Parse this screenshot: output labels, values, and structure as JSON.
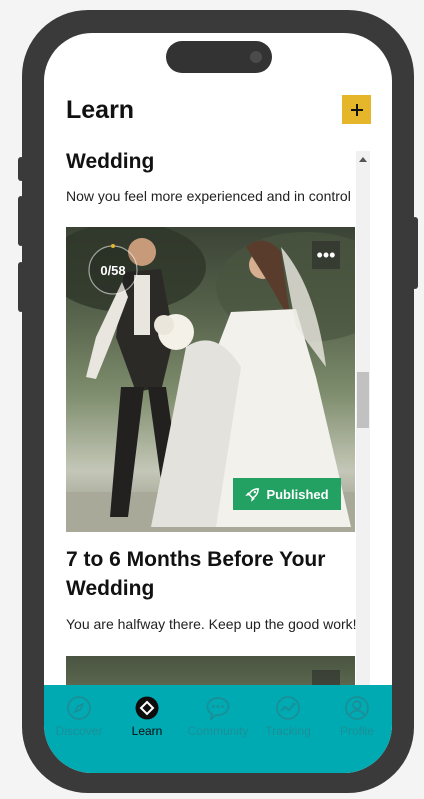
{
  "header": {
    "title": "Learn",
    "add_label": "+"
  },
  "cards": [
    {
      "title_line": "Wedding",
      "subtitle": "Now you feel more experienced and in control",
      "progress": "0/58",
      "badge": "Published",
      "more_label": "•••"
    },
    {
      "title": "7 to 6 Months Before Your Wedding",
      "subtitle": "You are halfway there. Keep up the good work!"
    }
  ],
  "nav": {
    "items": [
      {
        "label": "Discover",
        "icon": "compass-icon",
        "active": false
      },
      {
        "label": "Learn",
        "icon": "learn-icon",
        "active": true
      },
      {
        "label": "Community",
        "icon": "chat-bubble-icon",
        "active": false
      },
      {
        "label": "Tracking",
        "icon": "tracking-icon",
        "active": false
      },
      {
        "label": "Profile",
        "icon": "user-icon",
        "active": false
      }
    ]
  },
  "colors": {
    "accent": "#e5b52a",
    "nav_background": "#00aab3",
    "published_badge": "#22a163"
  }
}
